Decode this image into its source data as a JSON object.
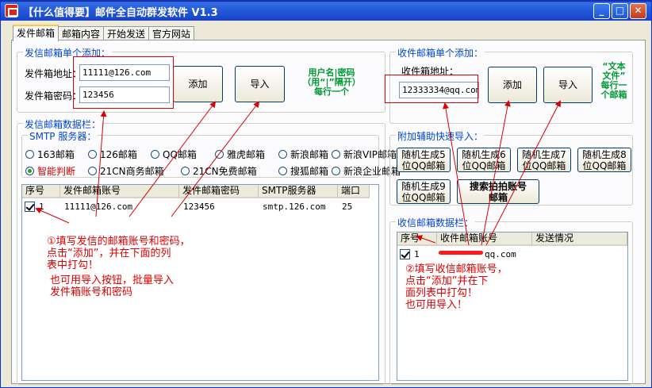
{
  "window": {
    "title": "【什么值得要】邮件全自动群发软件 V1.3",
    "min": "_",
    "max": "□",
    "close": "✕"
  },
  "tabs": [
    "发件邮箱",
    "邮箱内容",
    "开始发送",
    "官方网站"
  ],
  "sender_add": {
    "legend": "发信邮箱单个添加：",
    "addr_label": "发件箱地址：",
    "addr_value": "11111@126.com",
    "pwd_label": "发件箱密码：",
    "pwd_value": "123456",
    "add_btn": "添加",
    "import_btn": "导入",
    "note_lines": [
      "用户名|密码",
      "（用“|”隔开）",
      "每行一个"
    ]
  },
  "sender_data": {
    "legend": "发信邮箱数据栏：",
    "smtp_legend": "SMTP 服务器：",
    "servers": [
      {
        "label": "163邮箱",
        "selected": false
      },
      {
        "label": "126邮箱",
        "selected": false
      },
      {
        "label": "QQ邮箱",
        "selected": false
      },
      {
        "label": "雅虎邮箱",
        "selected": false
      },
      {
        "label": "新浪邮箱",
        "selected": false
      },
      {
        "label": "新浪VIP邮箱",
        "selected": false
      },
      {
        "label": "智能判断",
        "selected": true
      },
      {
        "label": "21CN商务邮箱",
        "selected": false
      },
      {
        "label": "21CN免费邮箱",
        "selected": false
      },
      {
        "label": "搜狐邮箱",
        "selected": false
      },
      {
        "label": "新浪企业邮箱",
        "selected": false
      }
    ],
    "columns": [
      "序号",
      "发件邮箱账号",
      "发件邮箱密码",
      "SMTP服务器",
      "端口"
    ],
    "rows": [
      {
        "no": "1",
        "account": "11111@126.com",
        "password": "123456",
        "smtp": "smtp.126.com",
        "port": "25",
        "checked": true
      }
    ]
  },
  "recv_add": {
    "legend": "收件邮箱单个添加：",
    "addr_label": "收件箱地址：",
    "addr_value": "12333334@qq.com",
    "add_btn": "添加",
    "import_btn": "导入",
    "note_lines": [
      "“文本",
      "文件”",
      "每行一",
      "个邮箱"
    ]
  },
  "aux_import": {
    "legend": "附加辅助快速导入：",
    "buttons": [
      [
        "随机生成5",
        "位QQ邮箱"
      ],
      [
        "随机生成6",
        "位QQ邮箱"
      ],
      [
        "随机生成7",
        "位QQ邮箱"
      ],
      [
        "随机生成8",
        "位QQ邮箱"
      ],
      [
        "随机生成9",
        "位QQ邮箱"
      ],
      [
        "搜索拍拍账号",
        "邮箱"
      ]
    ]
  },
  "recv_data": {
    "legend": "收信邮箱数据栏：",
    "columns": [
      "序号",
      "收件邮箱账号",
      "发送情况"
    ],
    "rows": [
      {
        "no": "1",
        "account_suffix": "qq.com",
        "status": "",
        "checked": true
      }
    ]
  },
  "annotations": {
    "left": [
      "①填写发信的邮箱账号和密码，",
      "点击“添加”，并在下面的列",
      "表中打勾！"
    ],
    "left2": [
      "也可用导入按钮，批量导入",
      "发件箱账号和密码"
    ],
    "right": [
      "②填写收信邮箱账号，",
      "点击“添加”并在下",
      "面列表中打勾！",
      "也可用导入！"
    ]
  },
  "colors": {
    "annotation": "#dd0000",
    "note": "#009933",
    "legend": "#0046d5"
  }
}
